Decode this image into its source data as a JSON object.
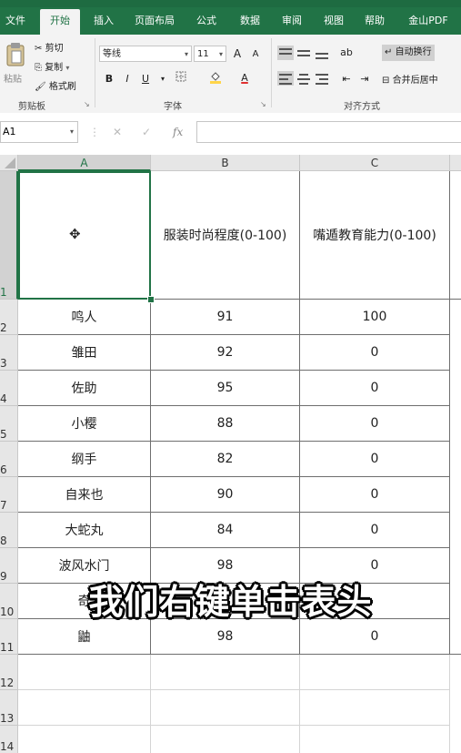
{
  "ribbon_tabs": [
    "文件",
    "开始",
    "插入",
    "页面布局",
    "公式",
    "数据",
    "审阅",
    "视图",
    "帮助",
    "金山PDF"
  ],
  "clipboard": {
    "paste": "粘贴",
    "cut": "剪切",
    "copy": "复制",
    "format_painter": "格式刷",
    "group": "剪贴板"
  },
  "font": {
    "name": "等线",
    "size": "11",
    "grow": "A",
    "shrink": "A",
    "bold": "B",
    "italic": "I",
    "underline": "U",
    "color_letter": "A",
    "group": "字体"
  },
  "alignment": {
    "wrap_text": "自动换行",
    "merge_center": "合并后居中",
    "group": "对齐方式"
  },
  "formula_bar": {
    "name_box": "A1",
    "fx": "fx",
    "value": ""
  },
  "columns": [
    "A",
    "B",
    "C"
  ],
  "rows": [
    "1",
    "2",
    "3",
    "4",
    "5",
    "6",
    "7",
    "8",
    "9",
    "10",
    "11",
    "12",
    "13",
    "14"
  ],
  "headers": {
    "a1": "",
    "b1": "服装时尚程度(0-100)",
    "c1": "嘴遁教育能力(0-100)"
  },
  "table": [
    {
      "name": "鸣人",
      "b": "91",
      "c": "100"
    },
    {
      "name": "雏田",
      "b": "92",
      "c": "0"
    },
    {
      "name": "佐助",
      "b": "95",
      "c": "0"
    },
    {
      "name": "小樱",
      "b": "88",
      "c": "0"
    },
    {
      "name": "纲手",
      "b": "82",
      "c": "0"
    },
    {
      "name": "自来也",
      "b": "90",
      "c": "0"
    },
    {
      "name": "大蛇丸",
      "b": "84",
      "c": "0"
    },
    {
      "name": "波风水门",
      "b": "98",
      "c": "0"
    },
    {
      "name": "奇",
      "b": "",
      "c": ""
    },
    {
      "name": "鼬",
      "b": "98",
      "c": "0"
    }
  ],
  "caption": "我们右键单击表头",
  "colors": {
    "brand": "#217346",
    "ribbon": "#f3f3f3",
    "grid_line": "#d4d4d4"
  }
}
